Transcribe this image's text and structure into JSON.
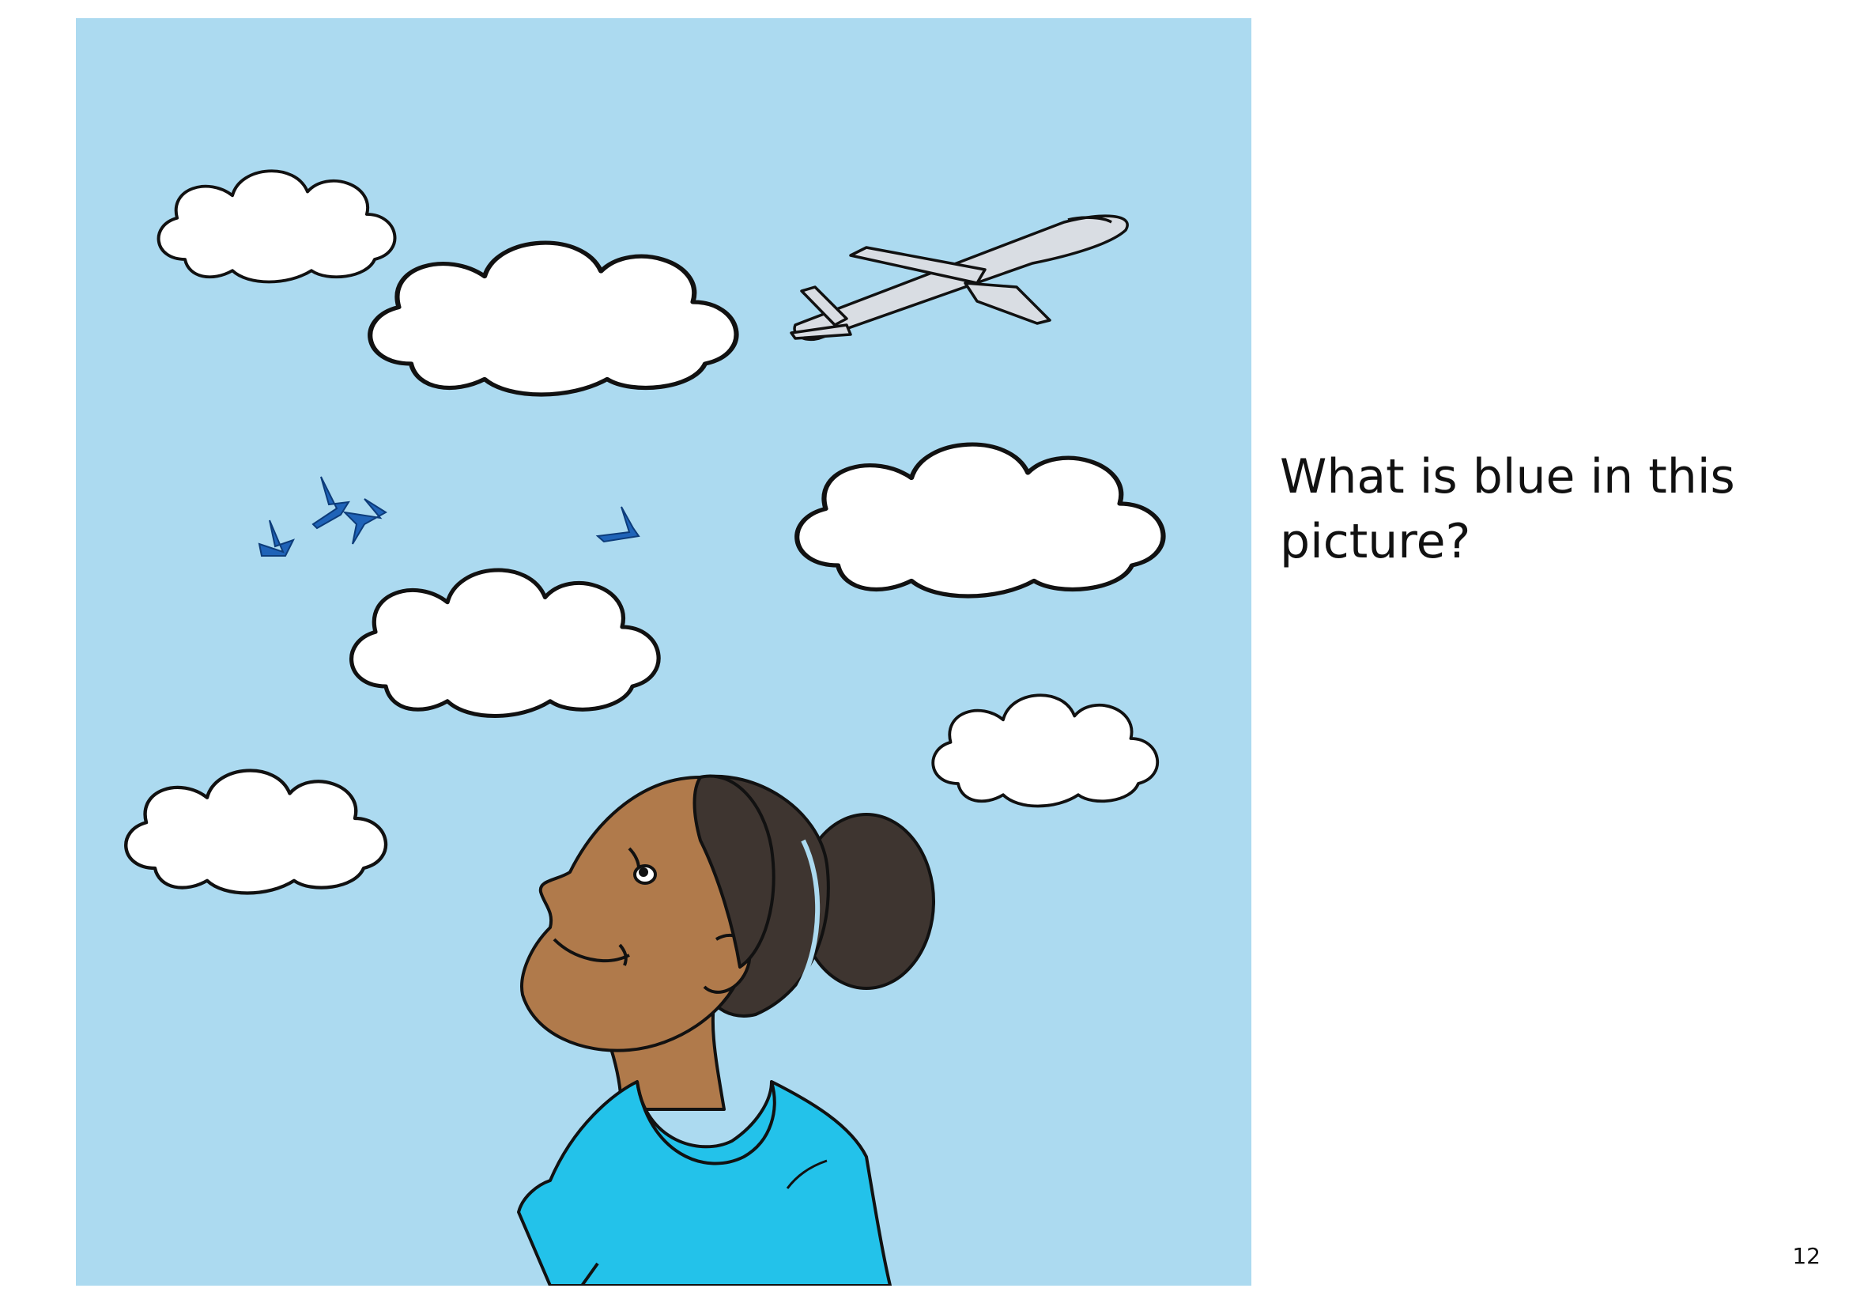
{
  "page": {
    "question": "What is blue in this picture?",
    "page_number": "12"
  },
  "illustration": {
    "subject": "girl-looking-up-at-sky",
    "elements": [
      "sky",
      "clouds",
      "airplane",
      "birds",
      "girl",
      "t-shirt"
    ],
    "colors": {
      "sky": "#acdaf0",
      "cloud": "#ffffff",
      "outline": "#111111",
      "airplane": "#d9dde3",
      "bird": "#1f63b8",
      "skin": "#b07a4b",
      "hair": "#3e3530",
      "shirt": "#23c2ea"
    }
  }
}
